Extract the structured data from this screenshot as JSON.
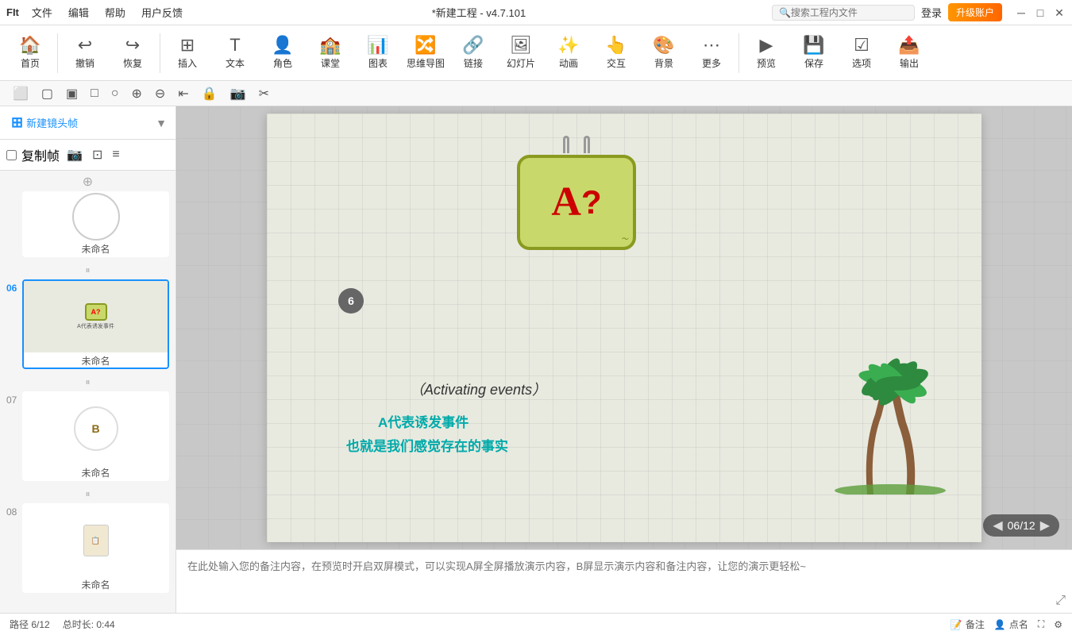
{
  "titlebar": {
    "logo": "FIt",
    "menus": [
      "文件",
      "编辑",
      "帮助",
      "用户反馈"
    ],
    "title": "*新建工程 - v4.7.101",
    "search_placeholder": "搜索工程内文件",
    "login": "登录",
    "upgrade": "升级账户"
  },
  "toolbar": {
    "items": [
      {
        "label": "首页",
        "icon": "🏠"
      },
      {
        "label": "撤销",
        "icon": "↩"
      },
      {
        "label": "恢复",
        "icon": "↪"
      },
      {
        "label": "插入",
        "icon": "➕"
      },
      {
        "label": "文本",
        "icon": "📄"
      },
      {
        "label": "角色",
        "icon": "👤"
      },
      {
        "label": "课堂",
        "icon": "🏫"
      },
      {
        "label": "图表",
        "icon": "📊"
      },
      {
        "label": "思维导图",
        "icon": "🔀"
      },
      {
        "label": "链接",
        "icon": "🔗"
      },
      {
        "label": "幻灯片",
        "icon": "🖼"
      },
      {
        "label": "动画",
        "icon": "⭐"
      },
      {
        "label": "交互",
        "icon": "👆"
      },
      {
        "label": "背景",
        "icon": "🎨"
      },
      {
        "label": "更多",
        "icon": "⋯"
      },
      {
        "label": "预览",
        "icon": "▶"
      },
      {
        "label": "保存",
        "icon": "💾"
      },
      {
        "label": "选项",
        "icon": "☑"
      },
      {
        "label": "输出",
        "icon": "📤"
      }
    ]
  },
  "sidebar": {
    "new_frame_label": "新建镜头帧",
    "copy_frame_label": "复制帧",
    "slides": [
      {
        "num": "",
        "label": "未命名",
        "type": "circle"
      },
      {
        "num": "06",
        "label": "未命名",
        "type": "slide6",
        "active": true
      },
      {
        "num": "07",
        "label": "未命名",
        "type": "slide7"
      },
      {
        "num": "08",
        "label": "未命名",
        "type": "slide8"
      }
    ]
  },
  "canvas": {
    "sign_text_a": "A",
    "sign_text_q": "?",
    "activating_text": "（Activating  events）",
    "chinese_text_1": "A代表诱发事件",
    "chinese_text_2": "也就是我们感觉存在的事实",
    "badge_num": "6",
    "page_current": "06",
    "page_total": "12"
  },
  "notes": {
    "placeholder": "在此处输入您的备注内容，在预览时开启双屏模式，可以实现A屏全屏播放演示内容，B屏显示演示内容和备注内容，让您的演示更轻松~"
  },
  "statusbar": {
    "path": "路径 6/12",
    "duration": "总时长: 0:44",
    "notes_label": "备注",
    "points_label": "点名"
  }
}
